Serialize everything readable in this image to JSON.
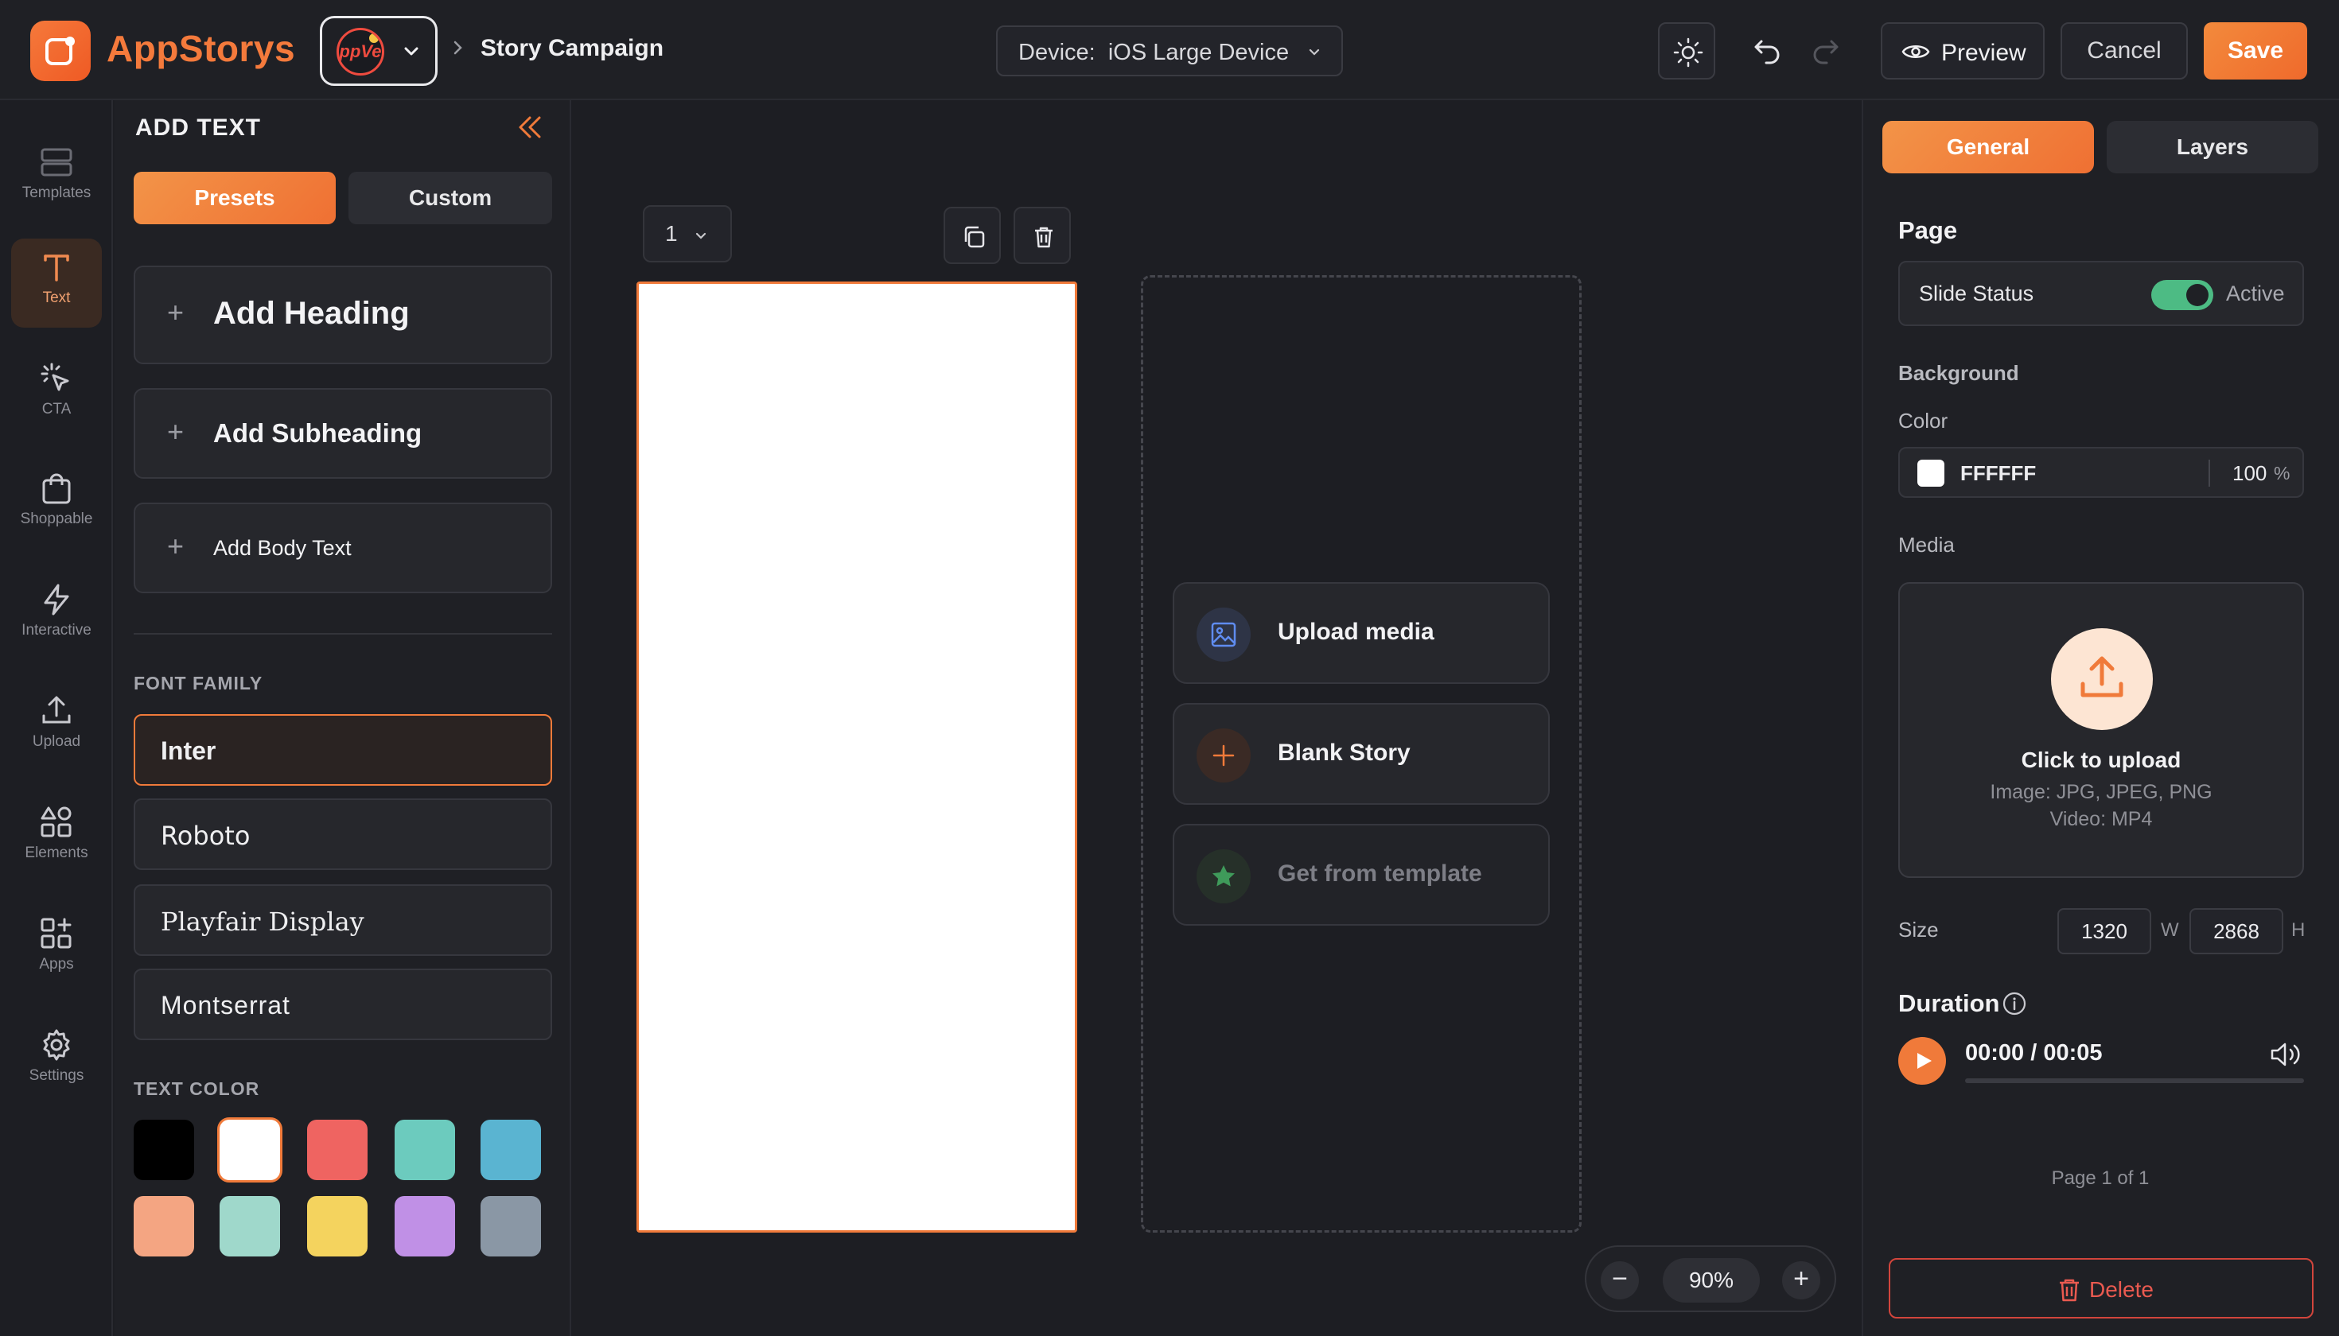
{
  "header": {
    "app_name": "AppStorys",
    "app_avatar_text": "ppVe",
    "breadcrumb_title": "Story Campaign",
    "device_label": "Device:",
    "device_value": "iOS Large Device",
    "preview_label": "Preview",
    "cancel_label": "Cancel",
    "save_label": "Save"
  },
  "rail": {
    "items": [
      {
        "label": "Templates",
        "icon": "templates-icon"
      },
      {
        "label": "Text",
        "icon": "text-icon",
        "active": true
      },
      {
        "label": "CTA",
        "icon": "cursor-click-icon"
      },
      {
        "label": "Shoppable",
        "icon": "shopping-bag-icon"
      },
      {
        "label": "Interactive",
        "icon": "lightning-icon"
      },
      {
        "label": "Upload",
        "icon": "upload-icon"
      },
      {
        "label": "Elements",
        "icon": "shapes-icon"
      },
      {
        "label": "Apps",
        "icon": "apps-grid-icon"
      },
      {
        "label": "Settings",
        "icon": "gear-icon"
      }
    ]
  },
  "panel": {
    "title": "ADD TEXT",
    "tabs": {
      "presets": "Presets",
      "custom": "Custom"
    },
    "add_heading": "Add Heading",
    "add_subheading": "Add Subheading",
    "add_body": "Add Body Text",
    "font_family_label": "FONT FAMILY",
    "fonts": [
      "Inter",
      "Roboto",
      "Playfair Display",
      "Montserrat"
    ],
    "selected_font": "Inter",
    "text_color_label": "TEXT COLOR",
    "colors": [
      "#000000",
      "#FFFFFF",
      "#EF6461",
      "#6CCBBE",
      "#5AB4D1",
      "#F4A582",
      "#9FD8CB",
      "#F4D35E",
      "#C090E6",
      "#8A97A5"
    ],
    "selected_color": "#FFFFFF"
  },
  "canvas": {
    "page_number": "1",
    "options": {
      "upload": "Upload media",
      "blank": "Blank Story",
      "template": "Get from template"
    },
    "zoom": "90%",
    "zoom_minus": "−",
    "zoom_plus": "+"
  },
  "right": {
    "tabs": {
      "general": "General",
      "layers": "Layers"
    },
    "page_heading": "Page",
    "slide_status_label": "Slide Status",
    "slide_status_value": "Active",
    "background_label": "Background",
    "color_label": "Color",
    "color_hex": "FFFFFF",
    "opacity": "100",
    "opacity_unit": "%",
    "media_label": "Media",
    "upload_title": "Click to upload",
    "upload_formats_image": "Image: JPG, JPEG, PNG",
    "upload_formats_video": "Video: MP4",
    "size_label": "Size",
    "width": "1320",
    "width_unit": "W",
    "height": "2868",
    "height_unit": "H",
    "duration_heading": "Duration",
    "time": "00:00 / 00:05",
    "progress": 0,
    "page_of": "Page 1 of 1",
    "delete_label": "Delete"
  },
  "colors": {
    "accent": "#F07A3A",
    "active_toggle": "#4DBB84",
    "danger": "#D2453C"
  }
}
